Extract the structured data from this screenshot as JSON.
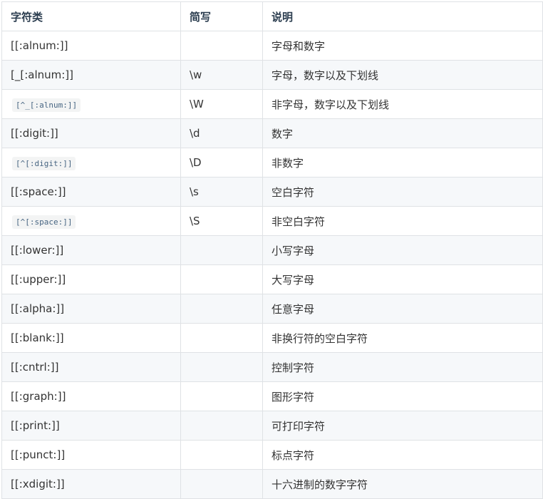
{
  "table": {
    "headers": [
      "字符类",
      "简写",
      "说明"
    ],
    "rows": [
      {
        "class": "[[:alnum:]]",
        "code": false,
        "short": "",
        "desc": "字母和数字"
      },
      {
        "class": "[_[:alnum:]]",
        "code": false,
        "short": "\\w",
        "desc": "字母，数字以及下划线"
      },
      {
        "class": "[^_[:alnum:]]",
        "code": true,
        "short": "\\W",
        "desc": "非字母，数字以及下划线"
      },
      {
        "class": "[[:digit:]]",
        "code": false,
        "short": "\\d",
        "desc": "数字"
      },
      {
        "class": "[^[:digit:]]",
        "code": true,
        "short": "\\D",
        "desc": "非数字"
      },
      {
        "class": "[[:space:]]",
        "code": false,
        "short": "\\s",
        "desc": "空白字符"
      },
      {
        "class": "[^[:space:]]",
        "code": true,
        "short": "\\S",
        "desc": "非空白字符"
      },
      {
        "class": "[[:lower:]]",
        "code": false,
        "short": "",
        "desc": "小写字母"
      },
      {
        "class": "[[:upper:]]",
        "code": false,
        "short": "",
        "desc": "大写字母"
      },
      {
        "class": "[[:alpha:]]",
        "code": false,
        "short": "",
        "desc": "任意字母"
      },
      {
        "class": "[[:blank:]]",
        "code": false,
        "short": "",
        "desc": "非换行符的空白字符"
      },
      {
        "class": "[[:cntrl:]]",
        "code": false,
        "short": "",
        "desc": "控制字符"
      },
      {
        "class": "[[:graph:]]",
        "code": false,
        "short": "",
        "desc": "图形字符"
      },
      {
        "class": "[[:print:]]",
        "code": false,
        "short": "",
        "desc": "可打印字符"
      },
      {
        "class": "[[:punct:]]",
        "code": false,
        "short": "",
        "desc": "标点字符"
      },
      {
        "class": "[[:xdigit:]]",
        "code": false,
        "short": "",
        "desc": "十六进制的数字字符"
      }
    ]
  }
}
